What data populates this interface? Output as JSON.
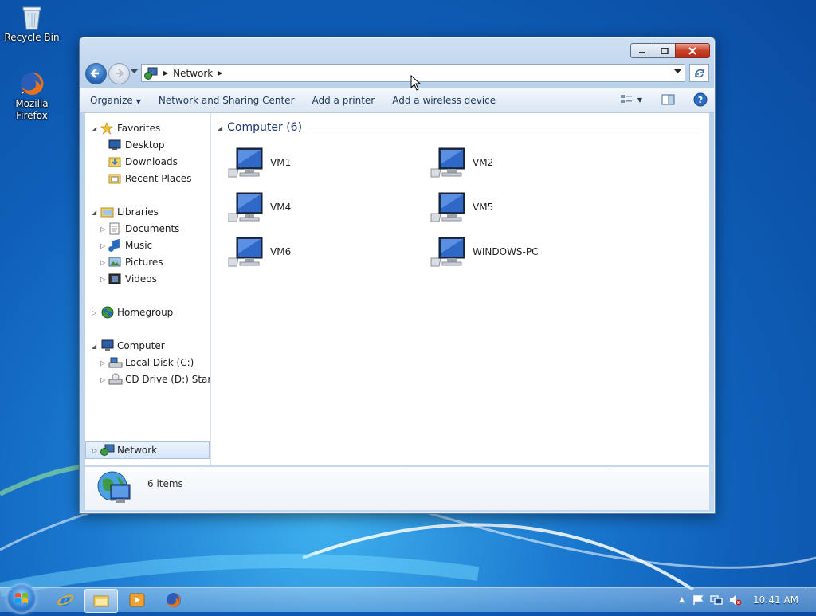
{
  "desktop": {
    "icons": [
      {
        "label": "Recycle Bin",
        "icon": "recycle-bin-icon"
      },
      {
        "label": "Mozilla Firefox",
        "icon": "firefox-icon"
      }
    ]
  },
  "window": {
    "address": {
      "crumbs": [
        "Network"
      ],
      "icon": "network-icon"
    },
    "toolbar": {
      "organize": "Organize",
      "network_center": "Network and Sharing Center",
      "add_printer": "Add a printer",
      "add_wireless": "Add a wireless device"
    },
    "navpane": {
      "favorites": "Favorites",
      "desktop": "Desktop",
      "downloads": "Downloads",
      "recent": "Recent Places",
      "libraries": "Libraries",
      "documents": "Documents",
      "music": "Music",
      "pictures": "Pictures",
      "videos": "Videos",
      "homegroup": "Homegroup",
      "computer": "Computer",
      "local_disk": "Local Disk (C:)",
      "cd_drive": "CD Drive (D:) Standa",
      "network": "Network"
    },
    "content": {
      "group_title": "Computer (6)",
      "items": [
        "VM1",
        "VM2",
        "VM4",
        "VM5",
        "VM6",
        "WINDOWS-PC"
      ]
    },
    "details": {
      "count": "6 items"
    }
  },
  "taskbar": {
    "clock": "10:41 AM",
    "apps": [
      "internet-explorer-icon",
      "windows-explorer-icon",
      "media-player-icon",
      "firefox-icon"
    ]
  },
  "colors": {
    "desktop": "#1a78cf",
    "link_text": "#1e395b",
    "group_title": "#1d3b72"
  }
}
